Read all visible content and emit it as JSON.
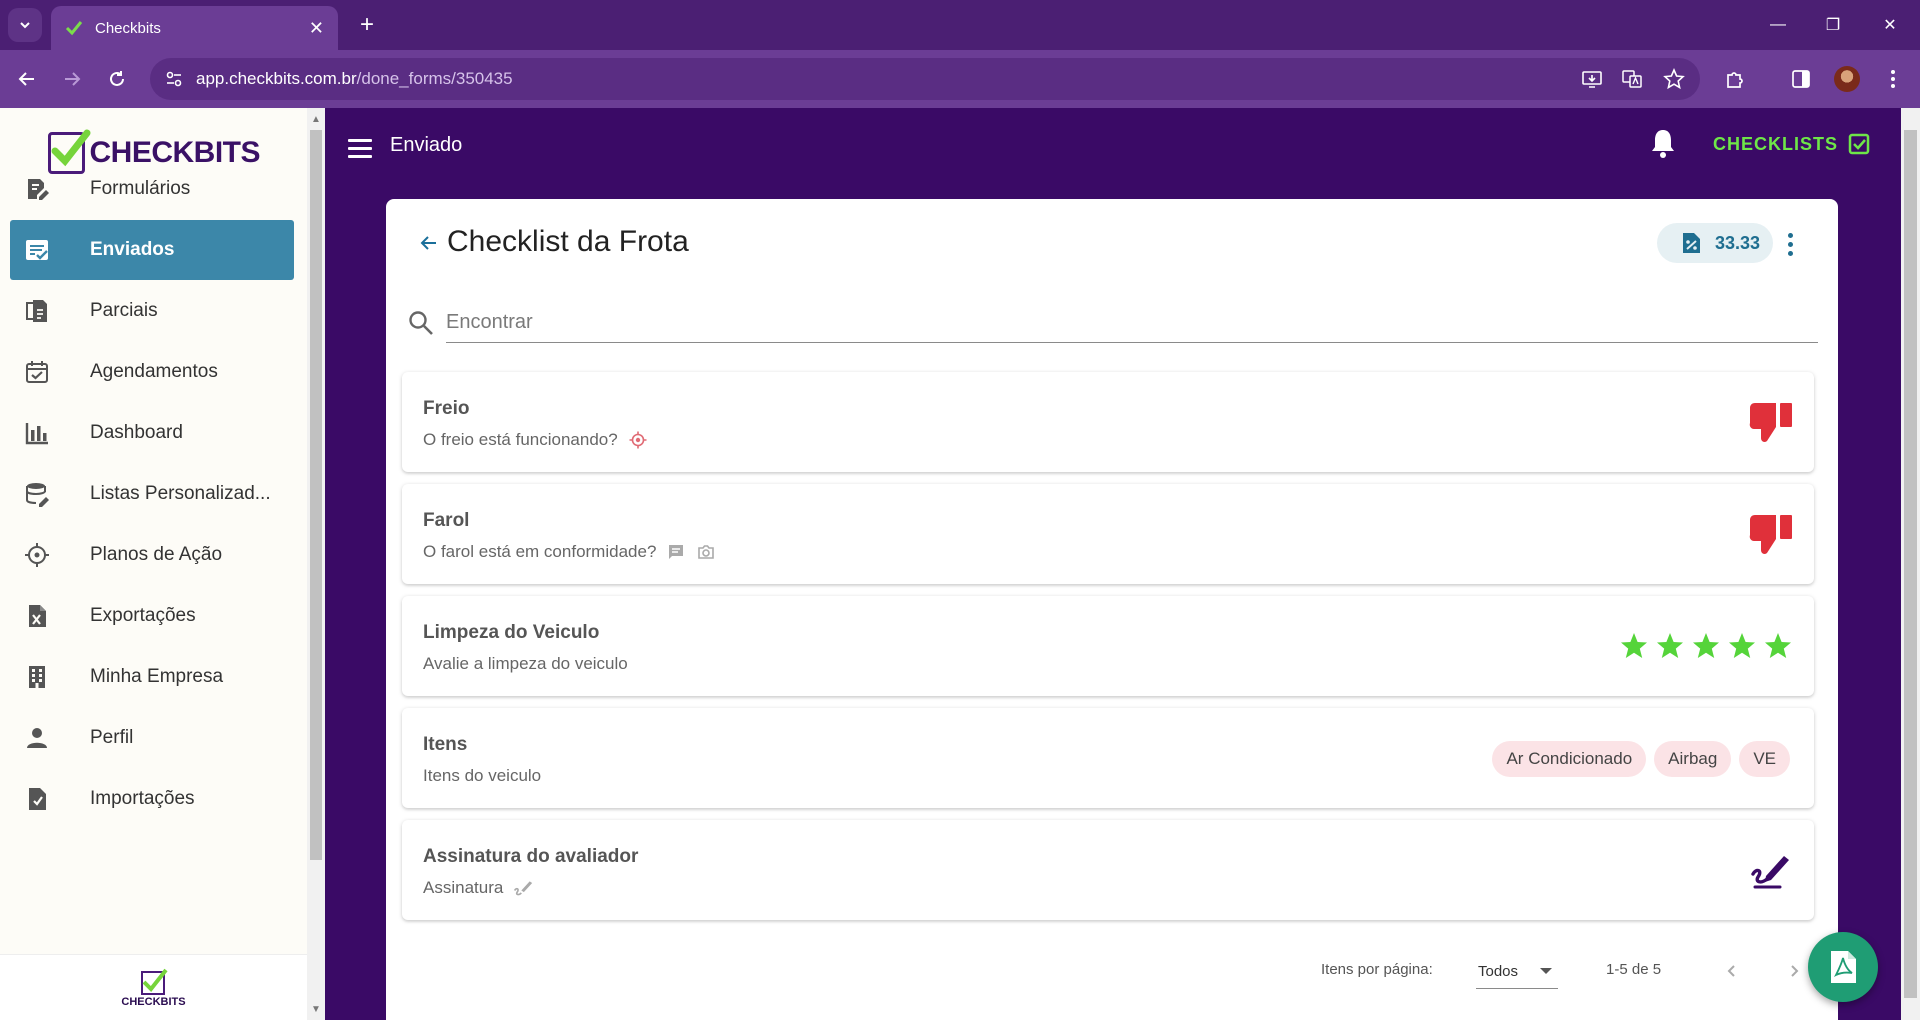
{
  "browser": {
    "tab_title": "Checkbits",
    "url_host": "app.checkbits.com.br",
    "url_path": "/done_forms/350435"
  },
  "sidebar": {
    "logo_text": "CHECKBITS",
    "footer_logo_text": "CHECKBITS",
    "items": [
      {
        "label": "Formulários",
        "icon": "form-edit-icon"
      },
      {
        "label": "Enviados",
        "icon": "sent-list-icon",
        "active": true
      },
      {
        "label": "Parciais",
        "icon": "partial-docs-icon"
      },
      {
        "label": "Agendamentos",
        "icon": "calendar-check-icon"
      },
      {
        "label": "Dashboard",
        "icon": "bar-chart-icon"
      },
      {
        "label": "Listas Personalizad...",
        "icon": "database-edit-icon"
      },
      {
        "label": "Planos de Ação",
        "icon": "crosshair-icon"
      },
      {
        "label": "Exportações",
        "icon": "excel-file-icon"
      },
      {
        "label": "Minha Empresa",
        "icon": "building-icon"
      },
      {
        "label": "Perfil",
        "icon": "person-icon"
      },
      {
        "label": "Importações",
        "icon": "file-import-icon"
      }
    ]
  },
  "header": {
    "title": "Enviado",
    "checklists_label": "CHECKLISTS"
  },
  "form": {
    "title": "Checklist da Frota",
    "score": "33.33",
    "search_placeholder": "Encontrar",
    "items": [
      {
        "title": "Freio",
        "subtitle": "O freio está funcionando?",
        "answer": "thumb-down"
      },
      {
        "title": "Farol",
        "subtitle": "O farol está em conformidade?",
        "answer": "thumb-down"
      },
      {
        "title": "Limpeza do Veiculo",
        "subtitle": "Avalie a limpeza do veiculo",
        "answer": "stars",
        "rating": 5,
        "rating_max": 5
      },
      {
        "title": "Itens",
        "subtitle": "Itens do veiculo",
        "answer": "chips",
        "chips": [
          "Ar Condicionado",
          "Airbag",
          "VE"
        ]
      },
      {
        "title": "Assinatura do avaliador",
        "subtitle": "Assinatura",
        "answer": "signature"
      }
    ]
  },
  "pagination": {
    "per_page_label": "Itens por página:",
    "per_page_value": "Todos",
    "range": "1-5 de 5"
  },
  "colors": {
    "brand_purple": "#3a0a66",
    "active_nav": "#3c87a9",
    "negative_red": "#e0303a",
    "star_green": "#55d43a",
    "checklists_green": "#6ee648",
    "pdf_fab": "#1f9d74"
  }
}
